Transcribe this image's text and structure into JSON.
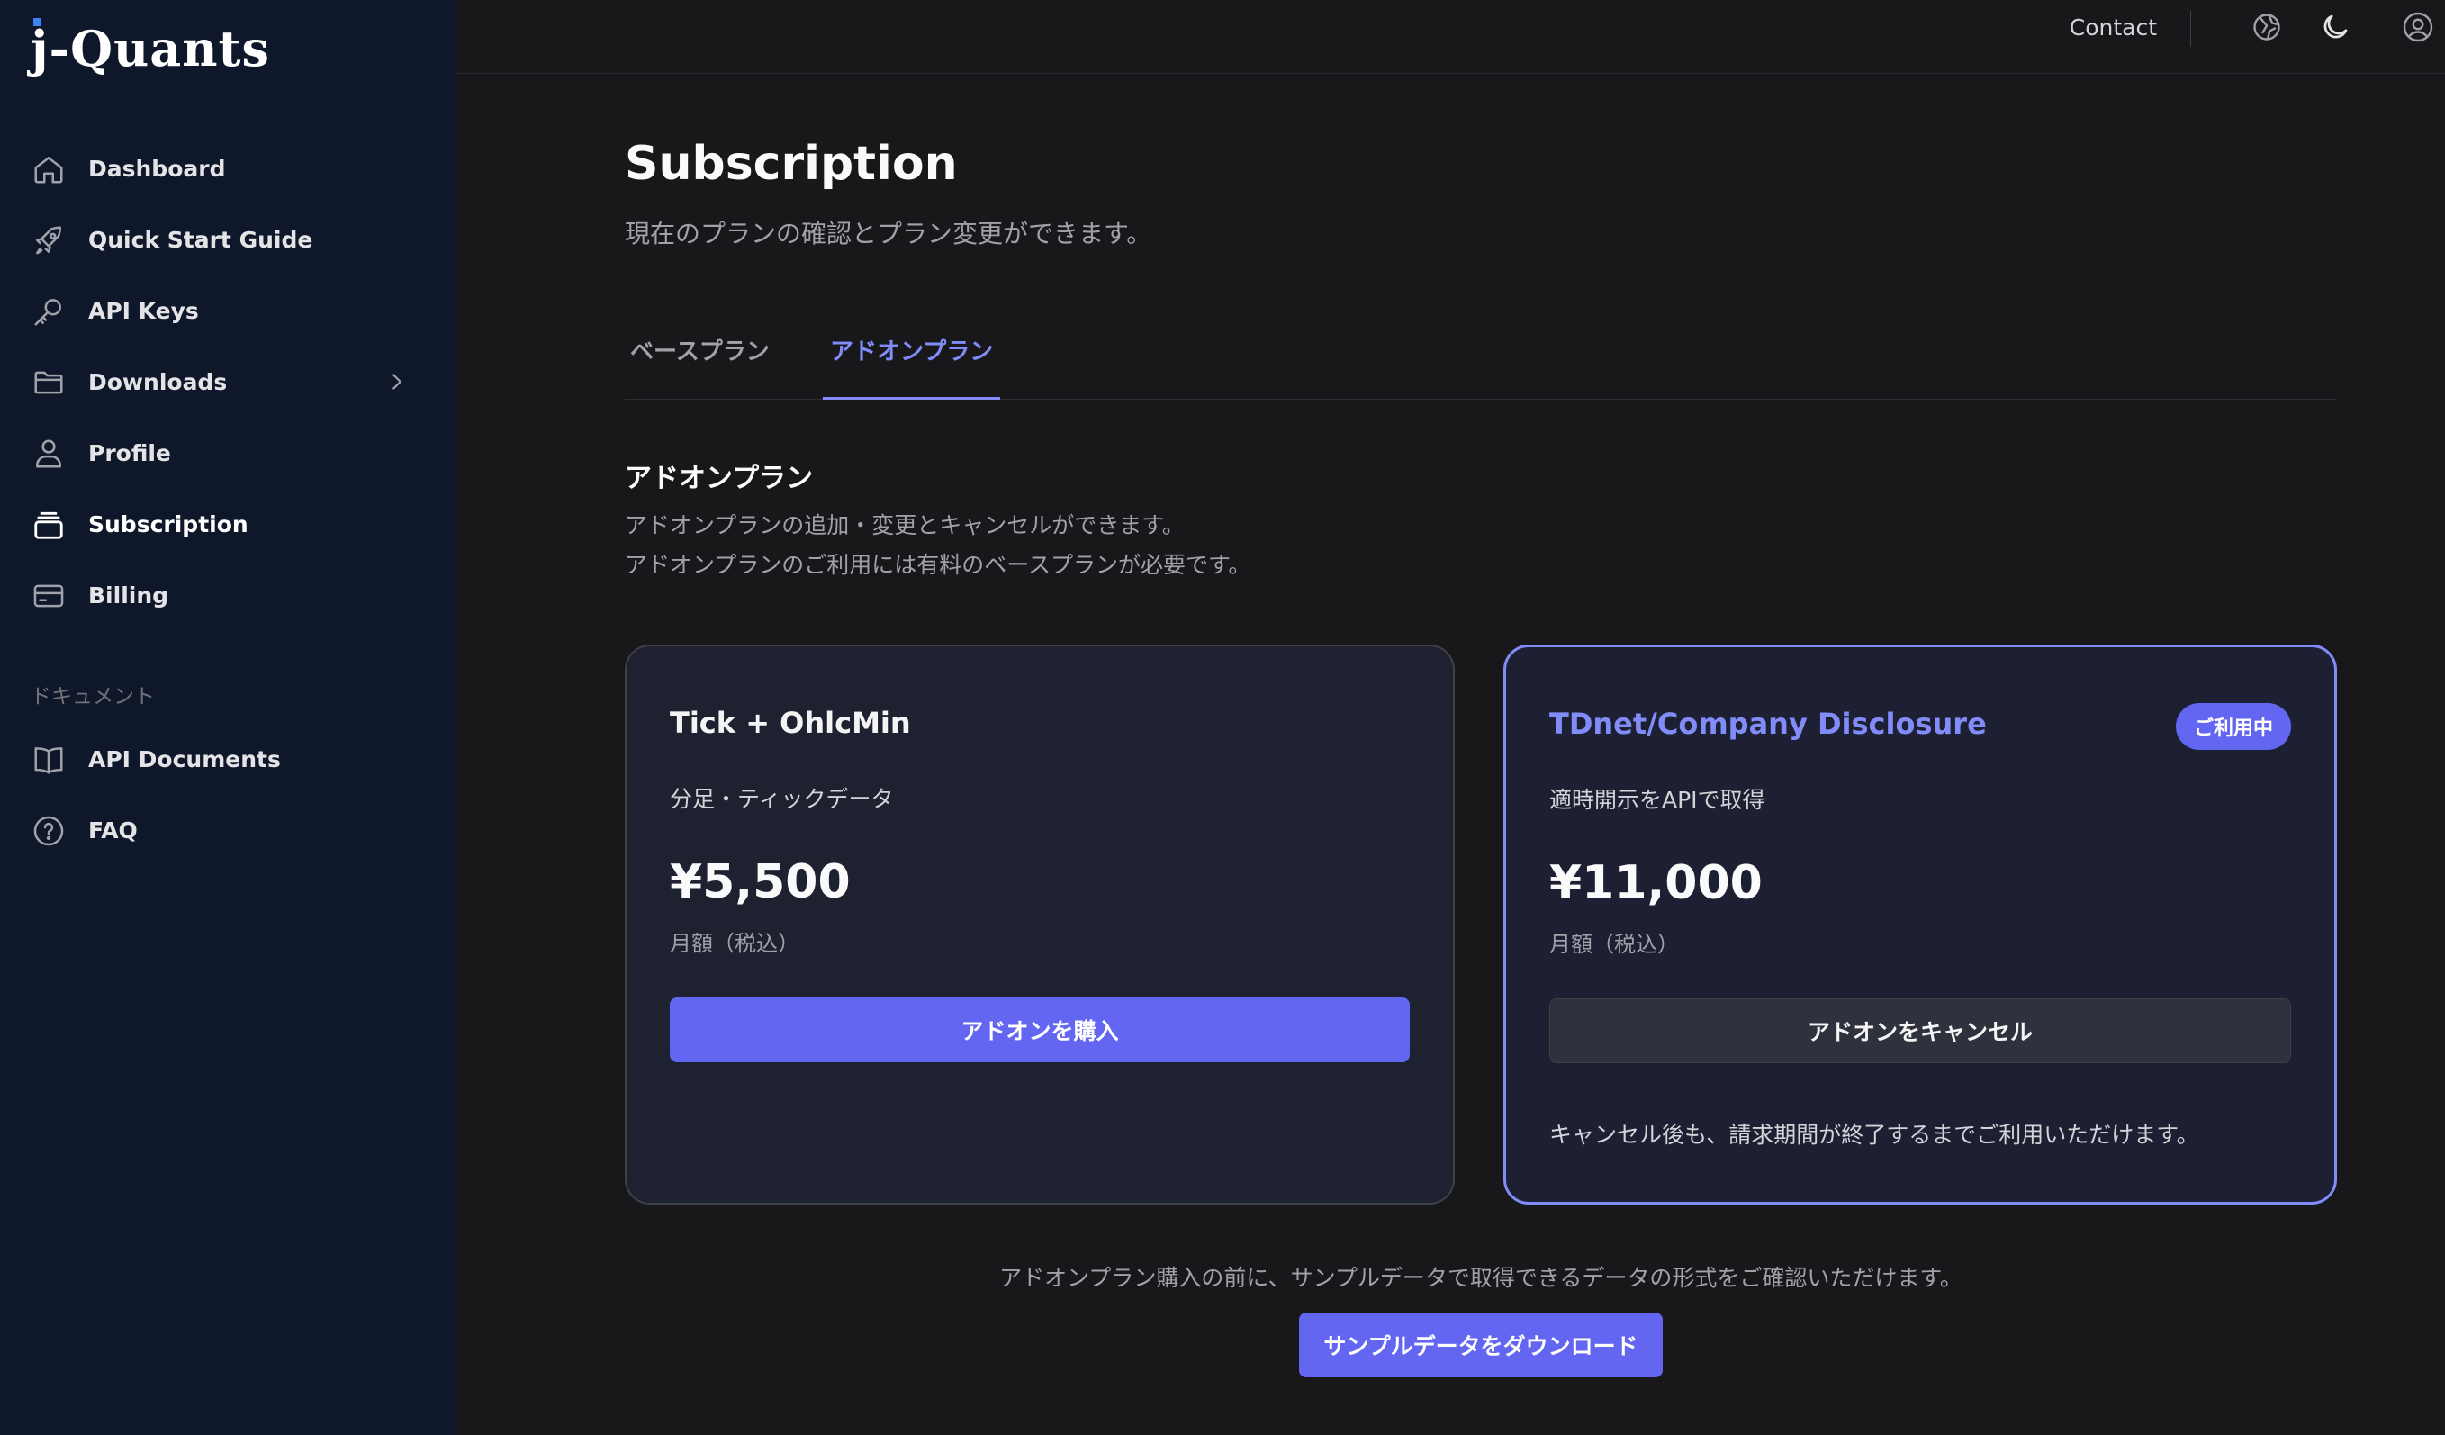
{
  "app": {
    "logo": "j-Quants"
  },
  "sidebar": {
    "items": [
      {
        "label": "Dashboard",
        "icon": "home-icon"
      },
      {
        "label": "Quick Start Guide",
        "icon": "rocket-icon"
      },
      {
        "label": "API Keys",
        "icon": "key-icon"
      },
      {
        "label": "Downloads",
        "icon": "folder-icon"
      },
      {
        "label": "Profile",
        "icon": "user-icon"
      },
      {
        "label": "Subscription",
        "icon": "subscription-icon",
        "active": true
      },
      {
        "label": "Billing",
        "icon": "credit-card-icon"
      }
    ],
    "section_label": "ドキュメント",
    "doc_items": [
      {
        "label": "API Documents",
        "icon": "book-icon"
      },
      {
        "label": "FAQ",
        "icon": "question-icon"
      }
    ]
  },
  "topbar": {
    "contact": "Contact",
    "icons": [
      "language-icon",
      "moon-icon",
      "account-icon"
    ]
  },
  "page": {
    "title": "Subscription",
    "subtitle": "現在のプランの確認とプラン変更ができます。"
  },
  "tabs": [
    {
      "label": "ベースプラン",
      "active": false
    },
    {
      "label": "アドオンプラン",
      "active": true
    }
  ],
  "section": {
    "title": "アドオンプラン",
    "desc1": "アドオンプランの追加・変更とキャンセルができます。",
    "desc2": "アドオンプランのご利用には有料のベースプランが必要です。"
  },
  "cards": [
    {
      "name": "Tick + OhlcMin",
      "desc": "分足・ティックデータ",
      "price": "¥5,500",
      "period": "月額（税込）",
      "button": "アドオンを購入"
    },
    {
      "name": "TDnet/Company Disclosure",
      "badge": "ご利用中",
      "desc": "適時開示をAPIで取得",
      "price": "¥11,000",
      "period": "月額（税込）",
      "button": "アドオンをキャンセル",
      "note": "キャンセル後も、請求期間が終了するまでご利用いただけます。"
    }
  ],
  "footer": {
    "note": "アドオンプラン購入の前に、サンプルデータで取得できるデータの形式をご確認いただけます。",
    "button": "サンプルデータをダウンロード"
  },
  "colors": {
    "accent": "#6366f1",
    "accent_text": "#818cf8",
    "sidebar_bg": "#0f172a",
    "main_bg": "#18181b"
  }
}
